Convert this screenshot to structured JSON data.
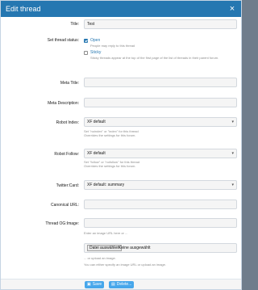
{
  "dialog": {
    "title": "Edit thread",
    "close": "×"
  },
  "fields": {
    "title": {
      "label": "Title:",
      "value": "Test"
    },
    "status": {
      "label": "Set thread status:",
      "open_label": "Open",
      "open_hint": "People may reply to this thread",
      "sticky_label": "Sticky",
      "sticky_hint": "Sticky threads appear at the top of the first page of the list of threads in their parent forum."
    },
    "meta_title": {
      "label": "Meta Title:",
      "value": ""
    },
    "meta_description": {
      "label": "Meta Description:",
      "value": ""
    },
    "robot_index": {
      "label": "Robot Index:",
      "value": "XF default",
      "hint1": "Set \"noindex\" or \"index\" for this thread",
      "hint2": "Overrides the settings for this forum."
    },
    "robot_follow": {
      "label": "Robot Follow:",
      "value": "XF default",
      "hint1": "Set \"follow\" or \"nofollow\" for this thread",
      "hint2": "Overrides the settings for this forum."
    },
    "twitter_card": {
      "label": "Twitter:Card:",
      "value": "XF default: summary"
    },
    "canonical_url": {
      "label": "Canonical URL:",
      "value": ""
    },
    "og_image": {
      "label": "Thread OG:Image:",
      "value": "",
      "hint_url": "Enter an image URL here or ...",
      "file_button": "Datei auswählen",
      "file_status": "Keine ausgewählt",
      "hint_upload": "... or upload an image.",
      "hint_either": "You can either specify an image URL or upload an image."
    }
  },
  "footer": {
    "save": "Save",
    "delete": "Delete..."
  },
  "icons": {
    "save": "save-icon",
    "delete": "trash-icon",
    "arrow": "chevron-down-icon"
  },
  "colors": {
    "accent": "#2577b1",
    "button": "#47a7eb"
  }
}
